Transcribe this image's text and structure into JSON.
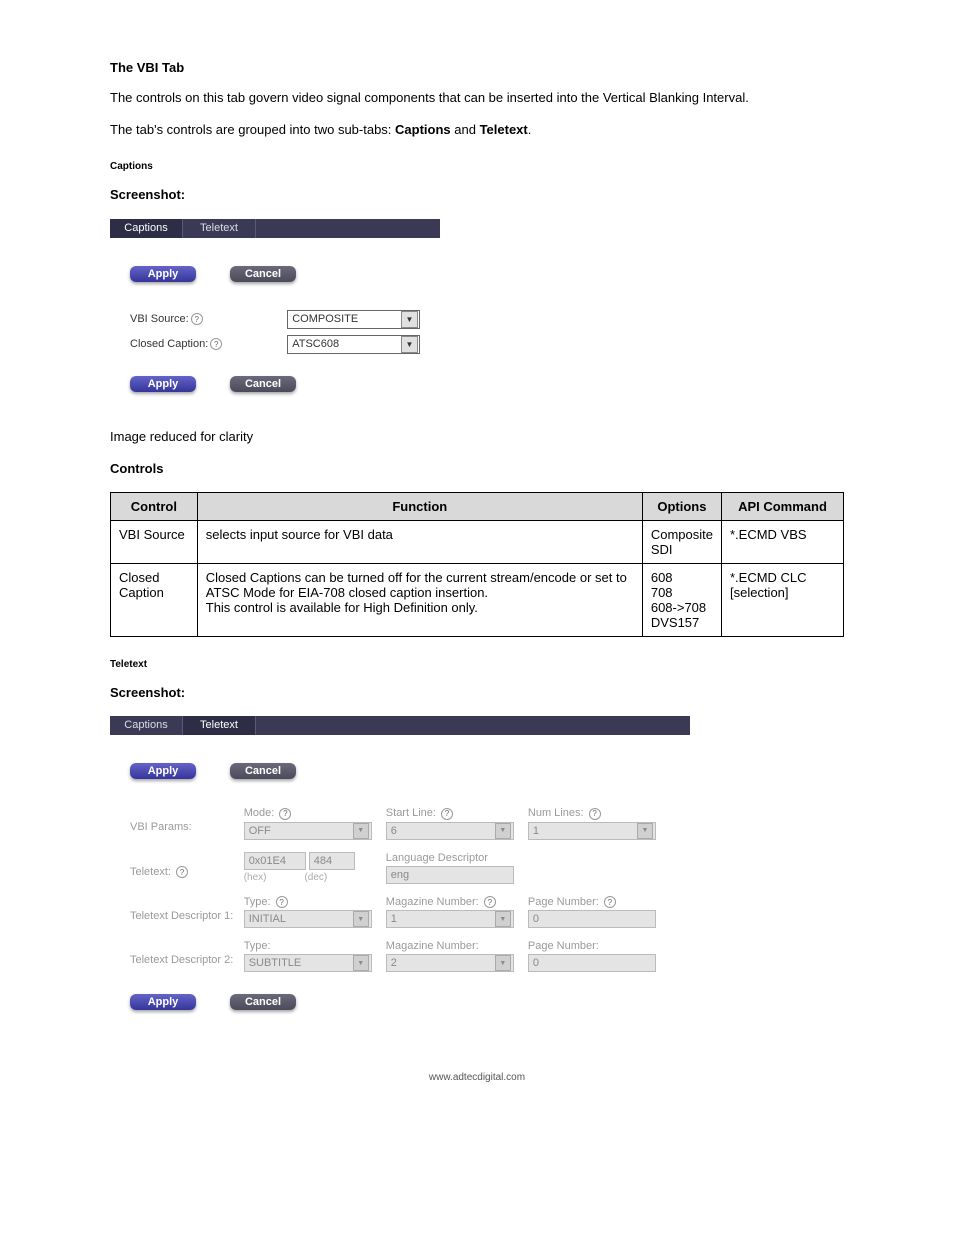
{
  "heading": "The VBI Tab",
  "intro1": "The controls on this tab govern video signal components that can be inserted into the Vertical Blanking Interval.",
  "intro2_a": "The tab's controls are grouped into two sub-tabs: ",
  "intro2_b": "Captions",
  "intro2_c": " and ",
  "intro2_d": "Teletext",
  "intro2_e": ".",
  "captions_title": "Captions",
  "screenshot_label": "Screenshot:",
  "shot1": {
    "tab_captions": "Captions",
    "tab_teletext": "Teletext",
    "apply": "Apply",
    "cancel": "Cancel",
    "vbi_source_label": "VBI Source:",
    "vbi_source_value": "COMPOSITE",
    "closed_caption_label": "Closed Caption:",
    "closed_caption_value": "ATSC608"
  },
  "image_note": "Image reduced for clarity",
  "controls_label": "Controls",
  "table": {
    "headers": {
      "control": "Control",
      "function": "Function",
      "options": "Options",
      "api": "API Command"
    },
    "r1": {
      "control": "VBI Source",
      "function": "selects input source for VBI data",
      "options": "Composite\nSDI",
      "api": "*.ECMD VBS"
    },
    "r2": {
      "control": "Closed Caption",
      "function": "Closed Captions can be turned off for the current stream/encode or set to ATSC Mode for EIA-708 closed caption insertion.\nThis control is available for High Definition only.",
      "options": "608\n708\n608->708\nDVS157",
      "api": "*.ECMD CLC [selection]"
    }
  },
  "teletext_title": "Teletext",
  "shot2": {
    "tab_captions": "Captions",
    "tab_teletext": "Teletext",
    "apply": "Apply",
    "cancel": "Cancel",
    "vbi_params": "VBI Params:",
    "mode_lbl": "Mode:",
    "mode_val": "OFF",
    "start_line_lbl": "Start Line:",
    "start_line_val": "6",
    "num_lines_lbl": "Num Lines:",
    "num_lines_val": "1",
    "teletext_lbl": "Teletext:",
    "hex_val": "0x01E4",
    "hex_cap": "(hex)",
    "dec_val": "484",
    "dec_cap": "(dec)",
    "langdesc_lbl": "Language Descriptor",
    "langdesc_val": "eng",
    "td1_lbl": "Teletext Descriptor 1:",
    "type_lbl": "Type:",
    "type1_val": "INITIAL",
    "mag_lbl": "Magazine Number:",
    "mag1_val": "1",
    "page_lbl": "Page Number:",
    "page1_val": "0",
    "td2_lbl": "Teletext Descriptor 2:",
    "type2_lbl": "Type:",
    "type2_val": "SUBTITLE",
    "mag2_lbl": "Magazine Number:",
    "mag2_val": "2",
    "page2_lbl": "Page Number:",
    "page2_val": "0"
  },
  "footer": "www.adtecdigital.com"
}
